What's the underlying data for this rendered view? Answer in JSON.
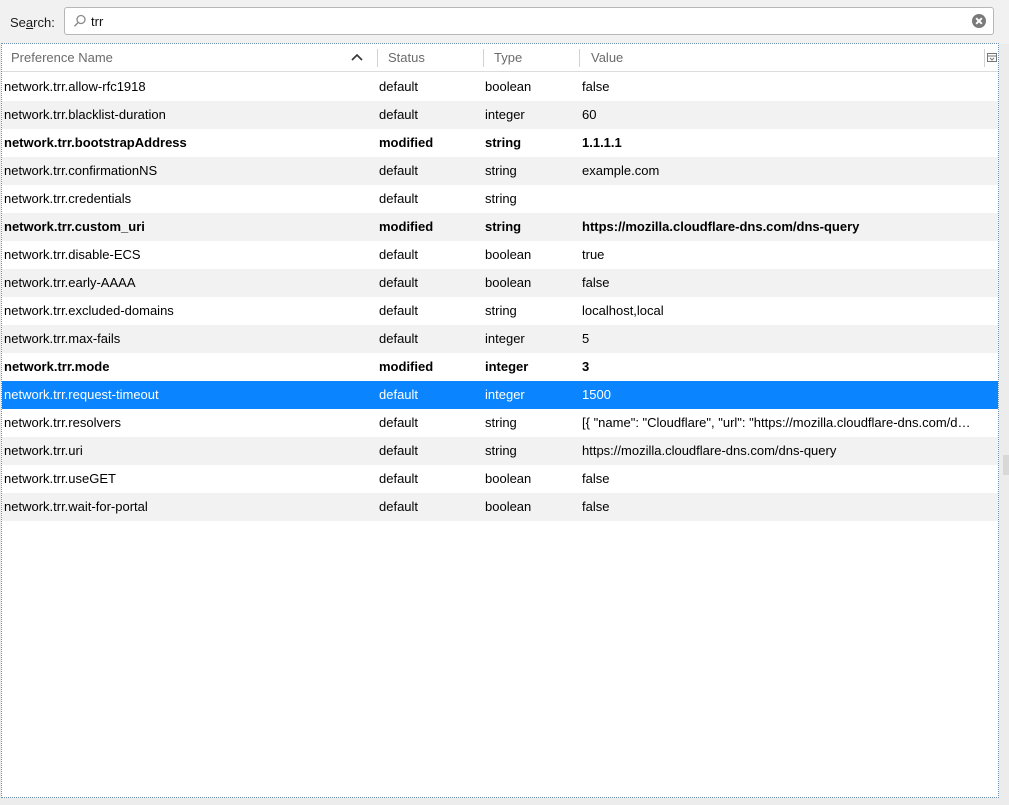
{
  "search": {
    "label_prefix": "Se",
    "label_accel": "a",
    "label_suffix": "rch:",
    "value": "trr"
  },
  "columns": {
    "name": "Preference Name",
    "status": "Status",
    "type": "Type",
    "value": "Value"
  },
  "icons": {
    "search": "search-icon",
    "clear": "clear-icon",
    "sort": "sort-ascending-icon",
    "column_picker": "column-picker-icon"
  },
  "colors": {
    "selection": "#0a84ff",
    "alt_row": "#f2f2f2"
  },
  "rows": [
    {
      "name": "network.trr.allow-rfc1918",
      "status": "default",
      "type": "boolean",
      "value": "false"
    },
    {
      "name": "network.trr.blacklist-duration",
      "status": "default",
      "type": "integer",
      "value": "60"
    },
    {
      "name": "network.trr.bootstrapAddress",
      "status": "modified",
      "type": "string",
      "value": "1.1.1.1"
    },
    {
      "name": "network.trr.confirmationNS",
      "status": "default",
      "type": "string",
      "value": "example.com"
    },
    {
      "name": "network.trr.credentials",
      "status": "default",
      "type": "string",
      "value": ""
    },
    {
      "name": "network.trr.custom_uri",
      "status": "modified",
      "type": "string",
      "value": "https://mozilla.cloudflare-dns.com/dns-query"
    },
    {
      "name": "network.trr.disable-ECS",
      "status": "default",
      "type": "boolean",
      "value": "true"
    },
    {
      "name": "network.trr.early-AAAA",
      "status": "default",
      "type": "boolean",
      "value": "false"
    },
    {
      "name": "network.trr.excluded-domains",
      "status": "default",
      "type": "string",
      "value": "localhost,local"
    },
    {
      "name": "network.trr.max-fails",
      "status": "default",
      "type": "integer",
      "value": "5"
    },
    {
      "name": "network.trr.mode",
      "status": "modified",
      "type": "integer",
      "value": "3"
    },
    {
      "name": "network.trr.request-timeout",
      "status": "default",
      "type": "integer",
      "value": "1500"
    },
    {
      "name": "network.trr.resolvers",
      "status": "default",
      "type": "string",
      "value": "[{ \"name\": \"Cloudflare\", \"url\": \"https://mozilla.cloudflare-dns.com/d…"
    },
    {
      "name": "network.trr.uri",
      "status": "default",
      "type": "string",
      "value": "https://mozilla.cloudflare-dns.com/dns-query"
    },
    {
      "name": "network.trr.useGET",
      "status": "default",
      "type": "boolean",
      "value": "false"
    },
    {
      "name": "network.trr.wait-for-portal",
      "status": "default",
      "type": "boolean",
      "value": "false"
    }
  ],
  "selected_row": 11
}
